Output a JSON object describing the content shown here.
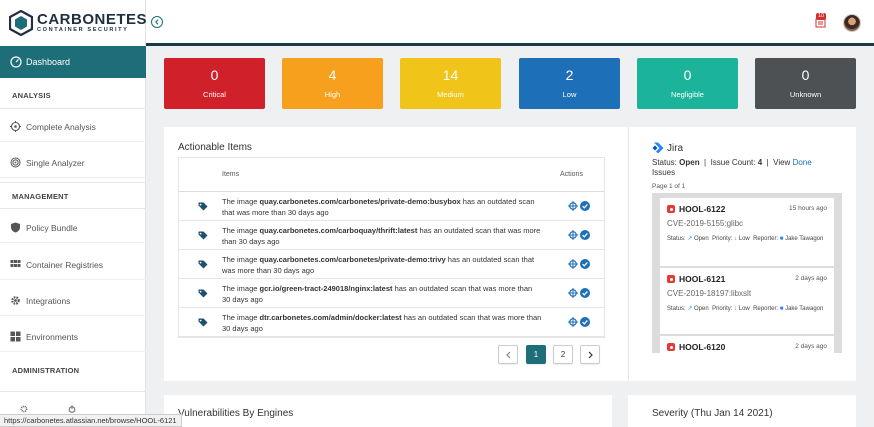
{
  "brand": {
    "name": "CARBONETES",
    "tagline": "CONTAINER SECURITY"
  },
  "sidebar": {
    "active": "Dashboard",
    "sections": [
      "ANALYSIS",
      "MANAGEMENT",
      "ADMINISTRATION"
    ],
    "analysis": [
      "Complete Analysis",
      "Single Analyzer"
    ],
    "management": [
      "Policy Bundle",
      "Container Registries",
      "Integrations",
      "Environments"
    ]
  },
  "topbar": {
    "notification_count": "10"
  },
  "severity": [
    {
      "count": "0",
      "label": "Critical",
      "color": "#d0202a"
    },
    {
      "count": "4",
      "label": "High",
      "color": "#f7a01e"
    },
    {
      "count": "14",
      "label": "Medium",
      "color": "#f0c419"
    },
    {
      "count": "2",
      "label": "Low",
      "color": "#1d6fb8"
    },
    {
      "count": "0",
      "label": "Negligible",
      "color": "#1cb39b"
    },
    {
      "count": "0",
      "label": "Unknown",
      "color": "#4d5154"
    }
  ],
  "actionable": {
    "title": "Actionable Items",
    "col_items": "Items",
    "col_actions": "Actions",
    "rows": [
      {
        "pre": "The image ",
        "image": "quay.carbonetes.com/carbonetes/private-demo:busybox",
        "post": " has an outdated scan that was more than 30 days ago"
      },
      {
        "pre": "The image ",
        "image": "quay.carbonetes.com/carboquay/thrift:latest",
        "post": " has an outdated scan that was more than 30 days ago"
      },
      {
        "pre": "The image ",
        "image": "quay.carbonetes.com/carbonetes/private-demo:trivy",
        "post": " has an outdated scan that was more than 30 days ago"
      },
      {
        "pre": "The image ",
        "image": "gcr.io/green-tract-249018/nginx:latest",
        "post": " has an outdated scan that was more than 30 days ago"
      },
      {
        "pre": "The image ",
        "image": "dtr.carbonetes.com/admin/docker:latest",
        "post": " has an outdated scan that was more than 30 days ago"
      }
    ],
    "pages": [
      "1",
      "2"
    ]
  },
  "jira": {
    "title": "Jira",
    "status_label": "Status:",
    "status_value": "Open",
    "count_label": "Issue Count:",
    "count_value": "4",
    "view_label": "View",
    "view_link": "Done",
    "issues_word": "Issues",
    "page_info": "Page 1 of 1",
    "issues": [
      {
        "key": "HOOL-6122",
        "ago": "15 hours ago",
        "cve": "CVE-2019-5155:glibc",
        "status": "Open",
        "priority": "Low",
        "reporter": "Jake Tawagon"
      },
      {
        "key": "HOOL-6121",
        "ago": "2 days ago",
        "cve": "CVE-2019-18197:libxslt",
        "status": "Open",
        "priority": "Low",
        "reporter": "Jake Tawagon"
      },
      {
        "key": "HOOL-6120",
        "ago": "2 days ago"
      }
    ]
  },
  "bottom": {
    "vuln_title": "Vulnerabilities By Engines",
    "severity_title": "Severity (Thu Jan 14 2021)"
  },
  "status_url": "https://carbonetes.atlassian.net/browse/HOOL-6121"
}
